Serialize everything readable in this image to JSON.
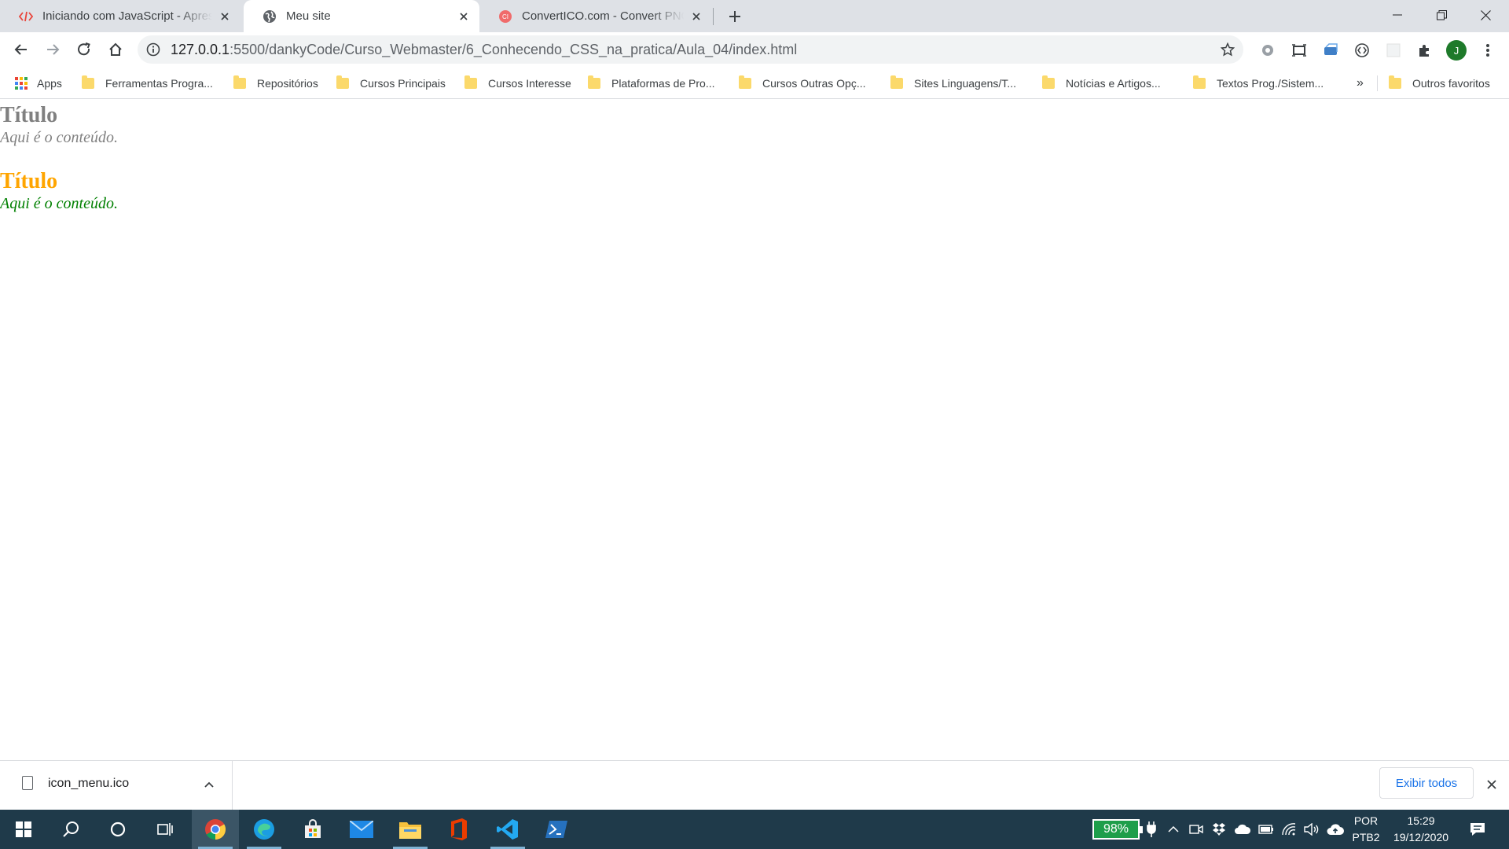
{
  "browser": {
    "tabs": [
      {
        "title": "Iniciando com JavaScript - Apresentação",
        "favicon": "code-icon",
        "active": false
      },
      {
        "title": "Meu site",
        "favicon": "globe-icon",
        "active": true
      },
      {
        "title": "ConvertICO.com - Convert PNG to ICO",
        "favicon": "converticon-icon",
        "active": false
      }
    ],
    "url_host": "127.0.0.1",
    "url_path": ":5500/dankyCode/Curso_Webmaster/6_Conhecendo_CSS_na_pratica/Aula_04/index.html",
    "profile_initial": "J",
    "bookmarks": [
      {
        "label": "Apps",
        "icon": "apps-grid-icon"
      },
      {
        "label": "Ferramentas Progra...",
        "icon": "folder-icon"
      },
      {
        "label": "Repositórios",
        "icon": "folder-icon"
      },
      {
        "label": "Cursos Principais",
        "icon": "folder-icon"
      },
      {
        "label": "Cursos Interesse",
        "icon": "folder-icon"
      },
      {
        "label": "Plataformas de Pro...",
        "icon": "folder-icon"
      },
      {
        "label": "Cursos Outras Opç...",
        "icon": "folder-icon"
      },
      {
        "label": "Sites Linguagens/T...",
        "icon": "folder-icon"
      },
      {
        "label": "Notícias e Artigos...",
        "icon": "folder-icon"
      },
      {
        "label": "Textos Prog./Sistem...",
        "icon": "folder-icon"
      }
    ],
    "bookmarks_overflow": "»",
    "other_bookmarks": "Outros favoritos"
  },
  "page": {
    "block1": {
      "title": "Título",
      "content": "Aqui é o conteúdo.",
      "title_color": "#808080",
      "content_color": "#808080"
    },
    "block2": {
      "title": "Título",
      "content": "Aqui é o conteúdo.",
      "title_color": "#ffa500",
      "content_color": "#008000"
    }
  },
  "downloads": {
    "file_name": "icon_menu.ico",
    "show_all": "Exibir todos"
  },
  "taskbar": {
    "apps": [
      "windows-start-icon",
      "search-icon",
      "cortana-icon",
      "task-view-icon",
      "chrome-icon",
      "edge-icon",
      "store-icon",
      "mail-icon",
      "file-explorer-icon",
      "office-icon",
      "vscode-icon",
      "powershell-icon"
    ],
    "battery": "98%",
    "language_top": "POR",
    "language_bottom": "PTB2",
    "time": "15:29",
    "date": "19/12/2020"
  }
}
